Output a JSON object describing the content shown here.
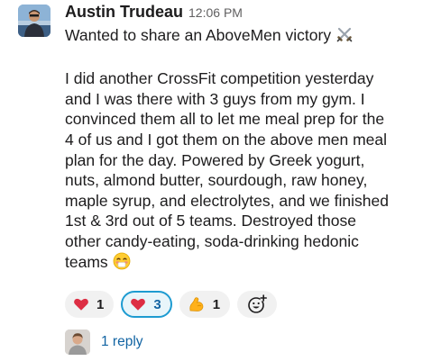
{
  "message": {
    "author": "Austin Trudeau",
    "timestamp": "12:06 PM",
    "avatar_icon": "user-avatar-photo",
    "lines": [
      "Wanted to share an AboveMen victory",
      "",
      "I did another CrossFit competition yesterday",
      "and I was there with 3 guys from my gym. I",
      "convinced them all to let me meal prep for the",
      "4 of us and I got them on the above men meal",
      "plan for the day. Powered by Greek yogurt,",
      "nuts, almond butter, sourdough, raw honey,",
      "maple syrup, and electrolytes, and we finished",
      "1st & 3rd out of 5 teams. Destroyed those",
      "other candy-eating, soda-drinking hedonic",
      "teams"
    ],
    "inline_emojis": [
      "crossed-swords-icon",
      "blushing-face-icon"
    ]
  },
  "reactions": [
    {
      "icon": "red-heart-icon",
      "count": "1",
      "selected": false
    },
    {
      "icon": "red-heart-icon",
      "count": "3",
      "selected": true
    },
    {
      "icon": "flexed-biceps-icon",
      "count": "1",
      "selected": false
    }
  ],
  "add_reaction_icon": "add-reaction-icon",
  "thread": {
    "reply_label": "1 reply",
    "avatar_icon": "replier-avatar-photo"
  },
  "colors": {
    "link": "#1264a3",
    "selected_reaction_border": "#1d9bd1",
    "selected_reaction_bg": "#e8f5fa",
    "reaction_bg": "#f1f1f1",
    "text": "#1d1c1d",
    "timestamp": "#616061"
  }
}
